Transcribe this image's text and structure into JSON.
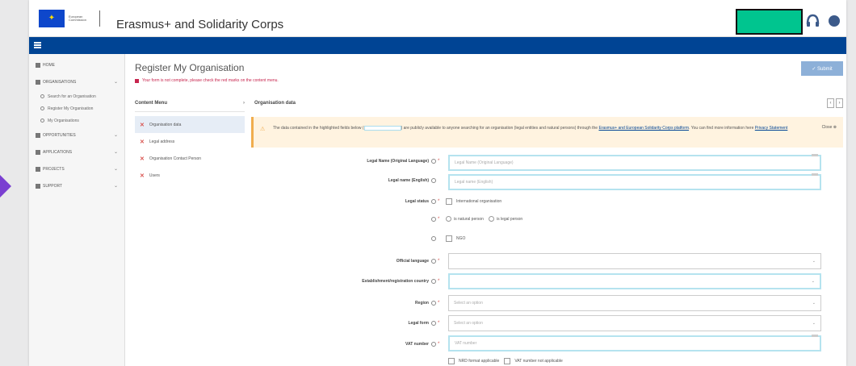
{
  "header": {
    "eu_logo_text": "European Commission",
    "app_title": "Erasmus+ and Solidarity Corps"
  },
  "sidebar": {
    "items": [
      {
        "label": "HOME",
        "icon": "home-icon"
      },
      {
        "label": "ORGANISATIONS",
        "icon": "building-icon"
      },
      {
        "label": "OPPORTUNITIES",
        "icon": "target-icon"
      },
      {
        "label": "APPLICATIONS",
        "icon": "document-icon"
      },
      {
        "label": "PROJECTS",
        "icon": "folder-icon"
      },
      {
        "label": "SUPPORT",
        "icon": "help-icon"
      }
    ],
    "sub_items": [
      {
        "label": "Search for an Organisation"
      },
      {
        "label": "Register My Organisation"
      },
      {
        "label": "My Organisations"
      }
    ]
  },
  "main": {
    "title": "Register My Organisation",
    "error": "Your form is not complete, please check the red marks on the content menu.",
    "submit_label": "✓ Submit"
  },
  "content_menu": {
    "header": "Content Menu",
    "items": [
      {
        "label": "Organisation data"
      },
      {
        "label": "Legal address"
      },
      {
        "label": "Organisation Contact Person"
      },
      {
        "label": "Users"
      }
    ]
  },
  "form": {
    "header": "Organisation data",
    "warning_text_1": "The data contained in the highlighted fields below (",
    "warning_text_2": ") are publicly available to anyone searching for an organisation (legal entities and natural persons) through the ",
    "warning_link_1": "Erasmus+ and European Solidarity Corps platform",
    "warning_text_3": ". You can find more information here ",
    "warning_link_2": "Privacy Statement",
    "warning_close": "Close",
    "fields": {
      "legal_name_orig": {
        "label": "Legal Name (Original Language)",
        "placeholder": "Legal Name (Original Language)"
      },
      "legal_name_en": {
        "label": "Legal name (English)",
        "placeholder": "Legal name (English)"
      },
      "legal_status": {
        "label": "Legal status",
        "option": "International organisation"
      },
      "person_type": {
        "option_1": "is natural person",
        "option_2": "is legal person"
      },
      "ngo": {
        "option": "NGO"
      },
      "official_language": {
        "label": "Official language"
      },
      "country": {
        "label": "Establishment/registration country"
      },
      "region": {
        "label": "Region",
        "placeholder": "Select an option"
      },
      "legal_form": {
        "label": "Legal form",
        "placeholder": "Select an option"
      },
      "vat": {
        "label": "VAT number",
        "placeholder": "VAT number"
      },
      "vat_options": {
        "option_1": "NRD format applicable",
        "option_2": "VAT number not applicable"
      }
    }
  }
}
